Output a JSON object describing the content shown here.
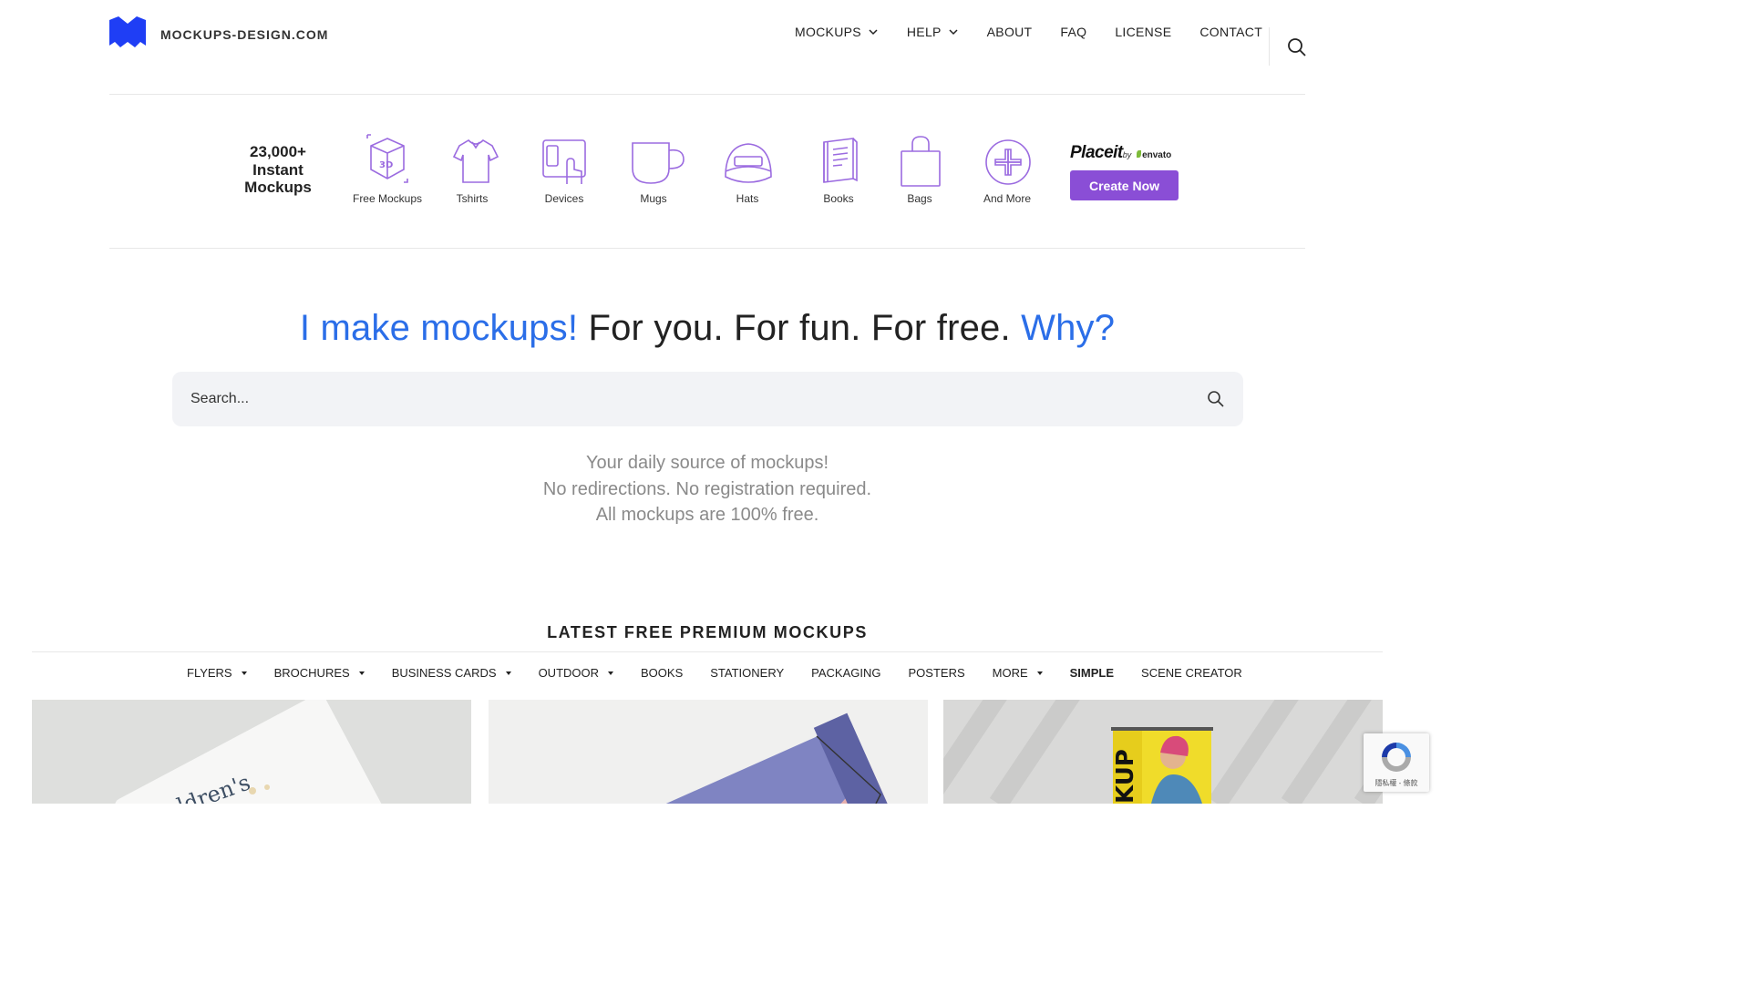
{
  "header": {
    "logo_text": "MOCKUPS-DESIGN.COM",
    "nav": [
      {
        "label": "MOCKUPS",
        "dropdown": true
      },
      {
        "label": "HELP",
        "dropdown": true
      },
      {
        "label": "ABOUT",
        "dropdown": false
      },
      {
        "label": "FAQ",
        "dropdown": false
      },
      {
        "label": "LICENSE",
        "dropdown": false
      },
      {
        "label": "CONTACT",
        "dropdown": false
      }
    ],
    "search_icon": "search-icon"
  },
  "placeit": {
    "count": "23,000+",
    "count_line2": "Instant",
    "count_line3": "Mockups",
    "categories": [
      {
        "label": "Free Mockups",
        "icon": "3d-box-icon"
      },
      {
        "label": "Tshirts",
        "icon": "tshirt-icon"
      },
      {
        "label": "Devices",
        "icon": "devices-icon"
      },
      {
        "label": "Mugs",
        "icon": "mug-icon"
      },
      {
        "label": "Hats",
        "icon": "hat-icon"
      },
      {
        "label": "Books",
        "icon": "book-icon"
      },
      {
        "label": "Bags",
        "icon": "bag-icon"
      },
      {
        "label": "And More",
        "icon": "plus-circle-icon"
      }
    ],
    "brand": "Placeit",
    "brand_by": "by",
    "brand_envato": "envato",
    "cta": "Create Now",
    "accent": "#8a4ed6",
    "icon_color": "#9b6be0"
  },
  "hero": {
    "part1": "I make mockups!",
    "part2": " For you. For fun. For free. ",
    "part3": "Why?",
    "accent": "#2b6ee8"
  },
  "search": {
    "placeholder": "Search..."
  },
  "tagline": {
    "line1": "Your daily source of mockups!",
    "line2": "No redirections. No registration required.",
    "line3": "All mockups are 100% free."
  },
  "latest": {
    "title": "LATEST FREE PREMIUM MOCKUPS",
    "filters": [
      {
        "label": "FLYERS",
        "dropdown": true,
        "active": false
      },
      {
        "label": "BROCHURES",
        "dropdown": true,
        "active": false
      },
      {
        "label": "BUSINESS CARDS",
        "dropdown": true,
        "active": false
      },
      {
        "label": "OUTDOOR",
        "dropdown": true,
        "active": false
      },
      {
        "label": "BOOKS",
        "dropdown": false,
        "active": false
      },
      {
        "label": "STATIONERY",
        "dropdown": false,
        "active": false
      },
      {
        "label": "PACKAGING",
        "dropdown": false,
        "active": false
      },
      {
        "label": "POSTERS",
        "dropdown": false,
        "active": false
      },
      {
        "label": "MORE",
        "dropdown": true,
        "active": false
      },
      {
        "label": "SIMPLE",
        "dropdown": false,
        "active": true
      },
      {
        "label": "SCENE CREATOR",
        "dropdown": false,
        "active": false
      }
    ],
    "cards": [
      {
        "text": "ldren's"
      },
      {
        "text": ""
      },
      {
        "text": "KUP"
      }
    ]
  },
  "recaptcha": {
    "text": "隱私權 - 條款"
  }
}
